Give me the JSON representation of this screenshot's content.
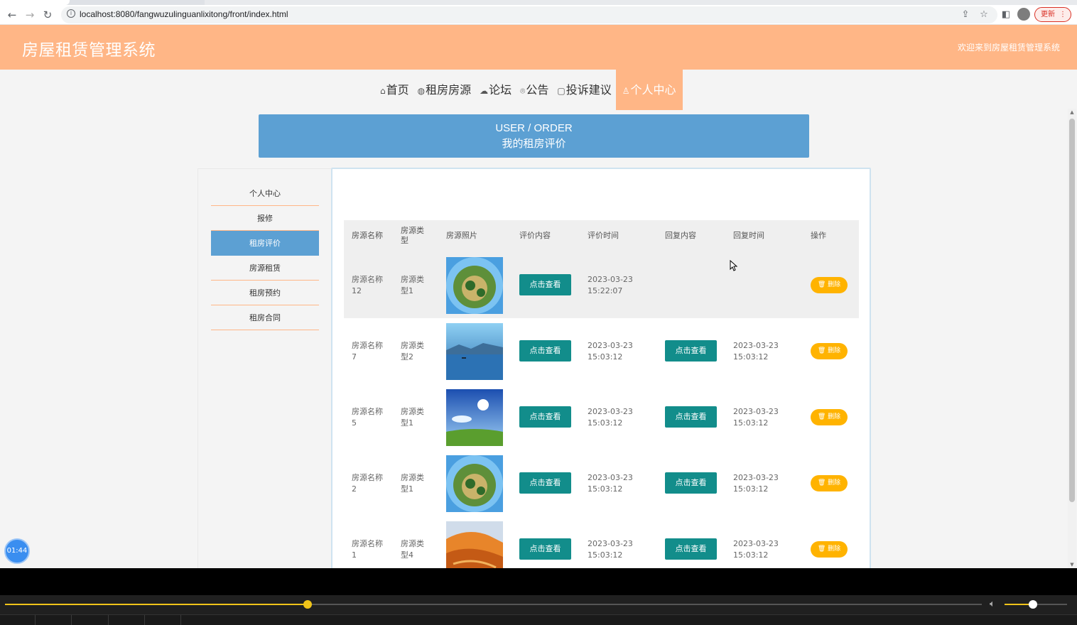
{
  "browser": {
    "url": "localhost:8080/fangwuzulinguanlixitong/front/index.html",
    "update_label": "更新"
  },
  "header": {
    "logo": "房屋租赁管理系统",
    "welcome": "欢迎来到房屋租赁管理系统"
  },
  "nav": [
    {
      "label": "首页",
      "icon": "home-icon",
      "glyph": "⌂"
    },
    {
      "label": "租房房源",
      "icon": "globe-icon",
      "glyph": "◍"
    },
    {
      "label": "论坛",
      "icon": "cloud-icon",
      "glyph": "☁"
    },
    {
      "label": "公告",
      "icon": "chat-icon",
      "glyph": "⌾"
    },
    {
      "label": "投诉建议",
      "icon": "note-icon",
      "glyph": "▢"
    },
    {
      "label": "个人中心",
      "icon": "user-icon",
      "glyph": "♙",
      "active": true
    }
  ],
  "banner": {
    "en": "USER / ORDER",
    "cn": "我的租房评价"
  },
  "sidebar": [
    {
      "label": "个人中心"
    },
    {
      "label": "报修"
    },
    {
      "label": "租房评价",
      "active": true
    },
    {
      "label": "房源租赁"
    },
    {
      "label": "租房预约"
    },
    {
      "label": "租房合同"
    }
  ],
  "table": {
    "headers": [
      "房源名称",
      "房源类型",
      "房源照片",
      "评价内容",
      "评价时间",
      "回复内容",
      "回复时间",
      "操作"
    ],
    "view_label": "点击查看",
    "delete_label": "删除",
    "rows": [
      {
        "name": "房源名称12",
        "type": "房源类型1",
        "photo": "planet",
        "eval_time": "2023-03-23 15:22:07",
        "has_reply": false,
        "reply_time": ""
      },
      {
        "name": "房源名称7",
        "type": "房源类型2",
        "photo": "lake",
        "eval_time": "2023-03-23 15:03:12",
        "has_reply": true,
        "reply_time": "2023-03-23 15:03:12"
      },
      {
        "name": "房源名称5",
        "type": "房源类型1",
        "photo": "sky",
        "eval_time": "2023-03-23 15:03:12",
        "has_reply": true,
        "reply_time": "2023-03-23 15:03:12"
      },
      {
        "name": "房源名称2",
        "type": "房源类型1",
        "photo": "planet",
        "eval_time": "2023-03-23 15:03:12",
        "has_reply": true,
        "reply_time": "2023-03-23 15:03:12"
      },
      {
        "name": "房源名称1",
        "type": "房源类型4",
        "photo": "canyon",
        "eval_time": "2023-03-23 15:03:12",
        "has_reply": true,
        "reply_time": "2023-03-23 15:03:12"
      }
    ]
  },
  "timer": "01:44",
  "player": {
    "progress": 0.31,
    "volume": 0.45
  },
  "colors": {
    "accent": "#ffb686",
    "blue": "#5ca0d3",
    "teal": "#128d8b",
    "amber": "#ffb300"
  }
}
